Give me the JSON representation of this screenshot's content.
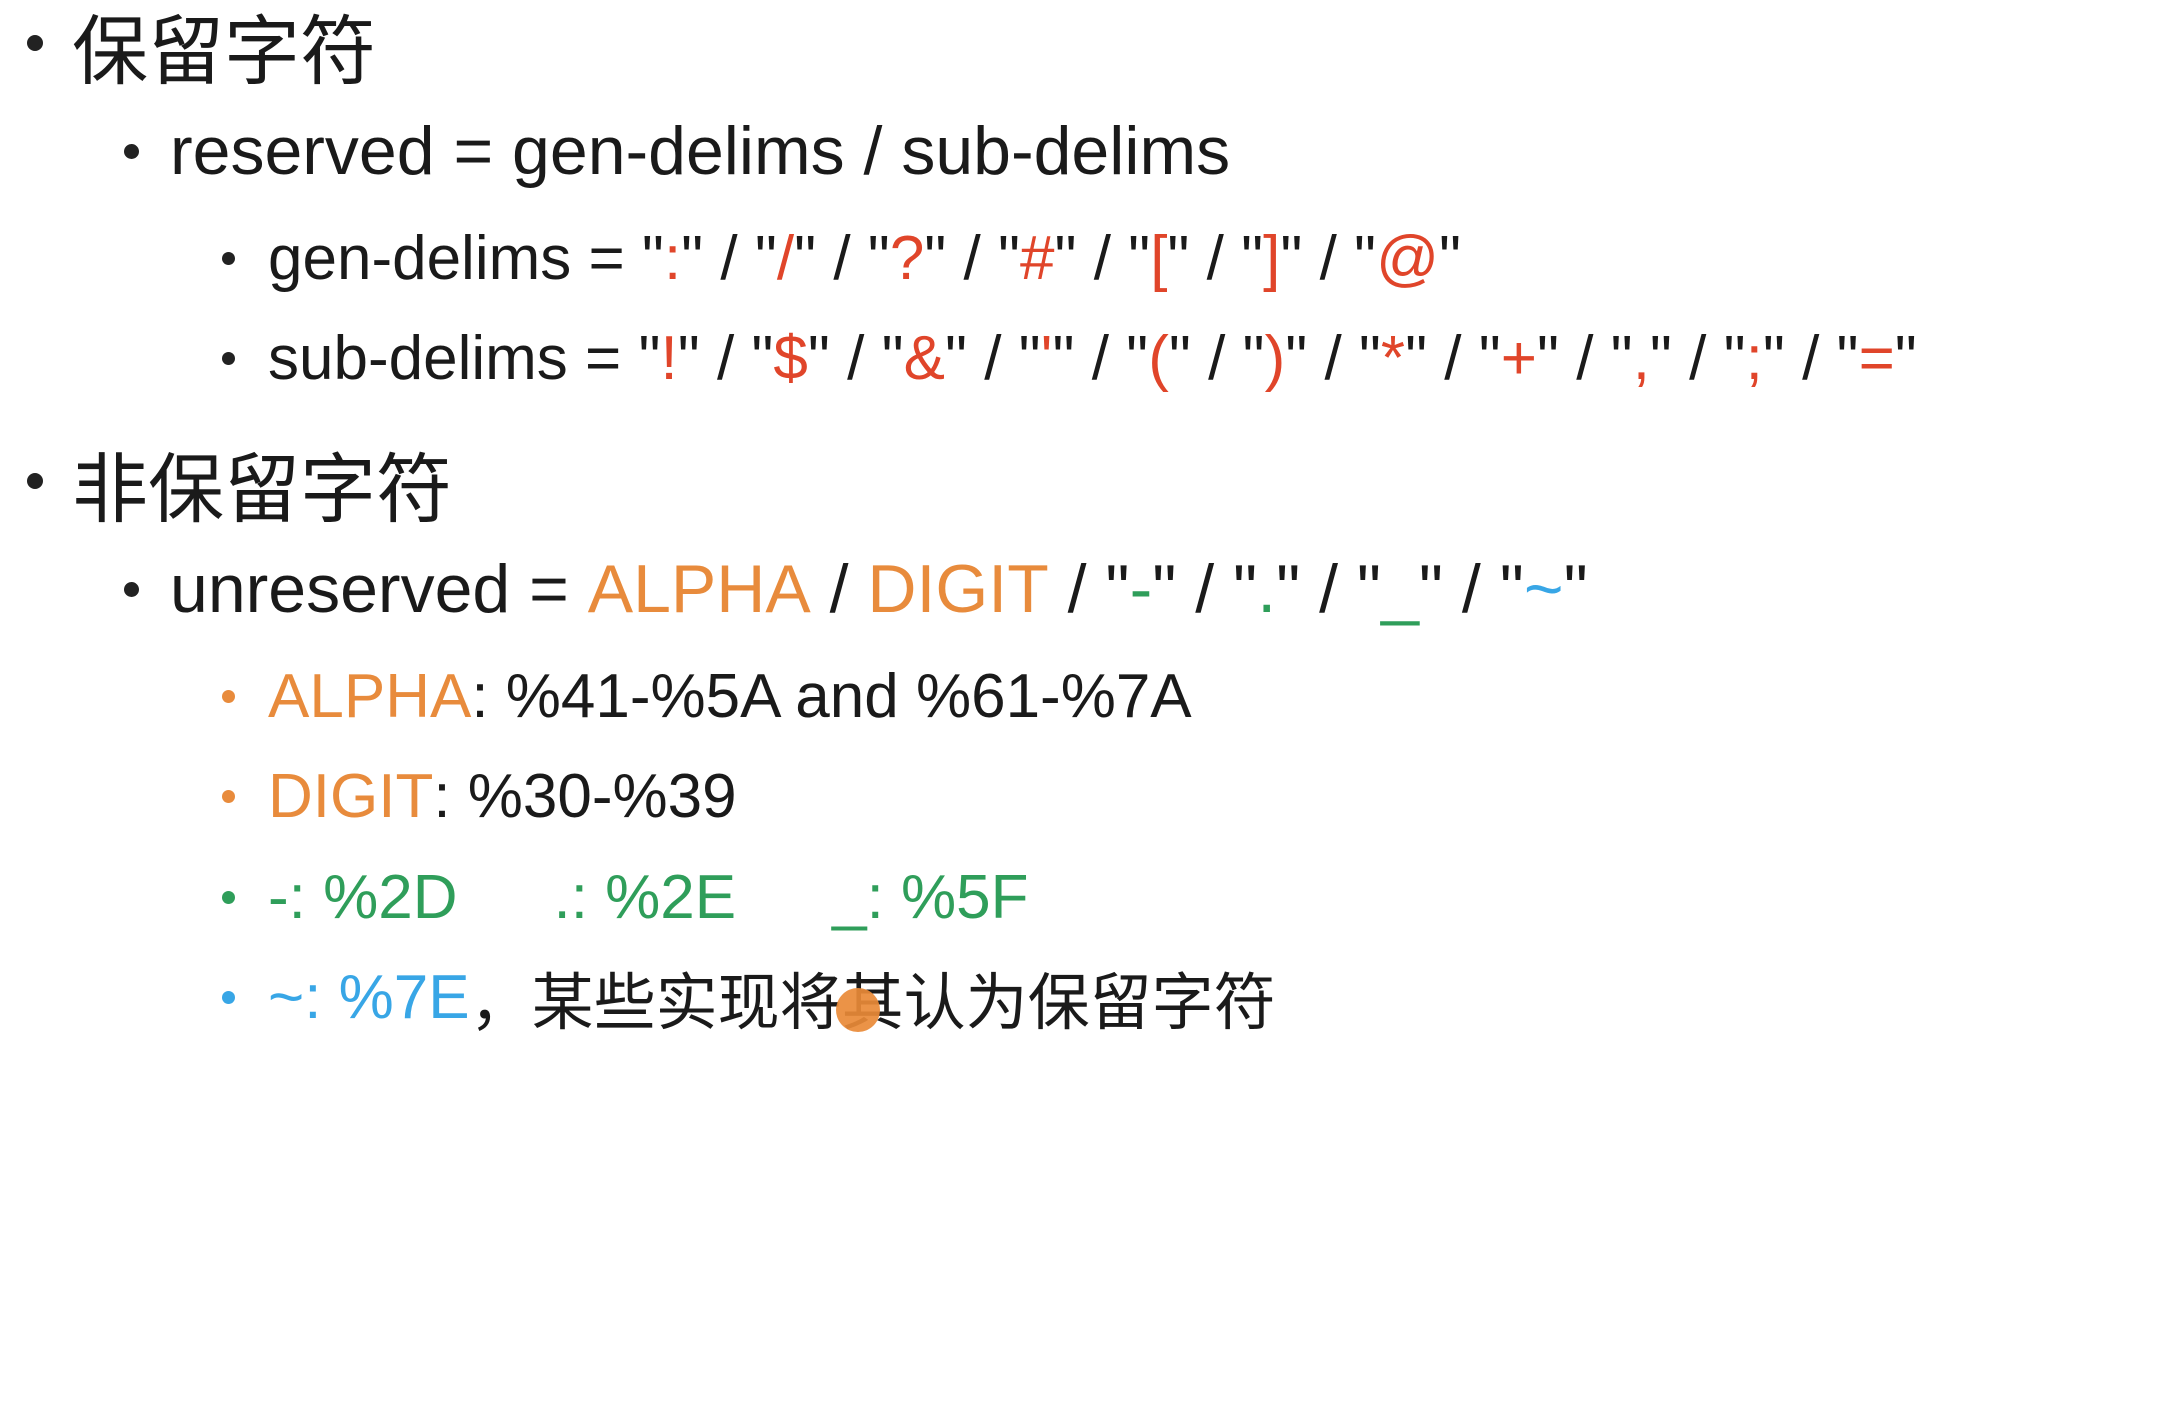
{
  "colors": {
    "text": "#1a1a1a",
    "red": "#e0452a",
    "orange": "#e88b3c",
    "green": "#2f9e5a",
    "blue": "#38a6e6"
  },
  "reserved_heading": "保留字符",
  "reserved_rule": "reserved = gen-delims / sub-delims",
  "gen_delims": {
    "name": "gen-delims",
    "chars": [
      ":",
      "/",
      "?",
      "#",
      "[",
      "]",
      "@"
    ]
  },
  "sub_delims": {
    "name": "sub-delims",
    "chars": [
      "!",
      "$",
      "&",
      "'",
      "(",
      ")",
      "*",
      "+",
      ",",
      ";",
      "="
    ]
  },
  "unreserved_heading": "非保留字符",
  "unreserved_rule": {
    "prefix": "unreserved = ",
    "alpha": "ALPHA",
    "digit": "DIGIT",
    "chars": [
      "-",
      ".",
      "_",
      "~"
    ]
  },
  "alpha_line": {
    "label": "ALPHA",
    "text": ": %41-%5A and %61-%7A"
  },
  "digit_line": {
    "label": "DIGIT",
    "text": ": %30-%39"
  },
  "symbol_codes": [
    "-: %2D",
    ".: %2E",
    "_: %5F"
  ],
  "tilde_line": {
    "code": "~: %7E",
    "note": "，某些实现将其认为保留字符"
  }
}
